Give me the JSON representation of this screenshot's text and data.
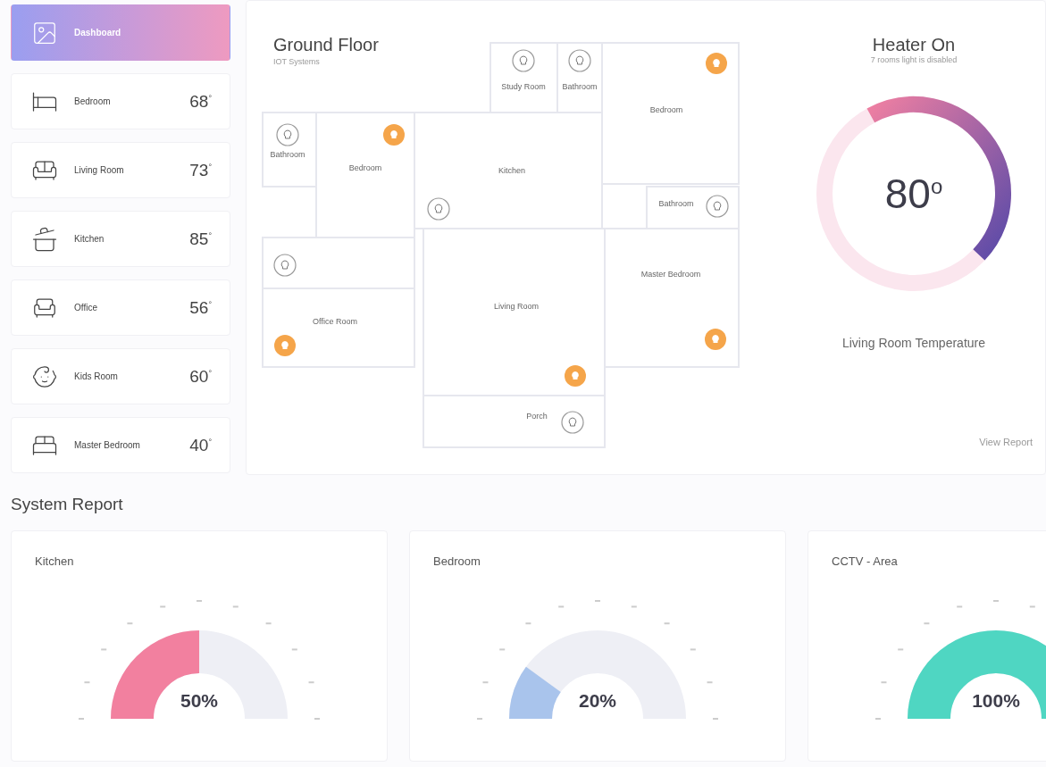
{
  "sidebar": {
    "items": [
      {
        "label": "Dashboard",
        "selected": true
      },
      {
        "label": "Bedroom",
        "temp": "68$^{°}$",
        "selected": false
      },
      {
        "label": "Living Room",
        "temp": "73$^{°}$",
        "selected": false
      },
      {
        "label": "Kitchen",
        "temp": "85$^{°}$",
        "selected": false
      },
      {
        "label": "Office",
        "temp": "56$^{°}$",
        "selected": false
      },
      {
        "label": "Kids Room",
        "temp": "60$^{°}$",
        "selected": false
      },
      {
        "label": "Master Bedroom",
        "temp": "40$^{°}$",
        "selected": false
      }
    ]
  },
  "floor_plan": {
    "title": "Ground Floor",
    "subtitle": "IOT Systems",
    "rooms": [
      "Study Room",
      "Bathroom",
      "Bedroom",
      "Bathroom",
      "Bedroom",
      "Kitchen",
      "Bathroom",
      "Office Room",
      "Living Room",
      "Master Bedroom",
      "Porch"
    ],
    "lights": [
      {
        "on": false
      },
      {
        "on": false
      },
      {
        "on": true
      },
      {
        "on": false
      },
      {
        "on": true
      },
      {
        "on": false
      },
      {
        "on": false
      },
      {
        "on": false
      },
      {
        "on": true
      },
      {
        "on": true
      },
      {
        "on": true
      },
      {
        "on": false
      }
    ]
  },
  "heater": {
    "title": "Heater On",
    "subtitle": "7 rooms light is disabled",
    "reading": "80$^{o}$",
    "caption": "Living Room Temperature",
    "link": "View Report"
  },
  "system_report": {
    "title": "System Report",
    "cards": [
      {
        "title": "Kitchen",
        "reading": "50%"
      },
      {
        "title": "Bedroom",
        "reading": "20%"
      },
      {
        "title": "CCTV - Area",
        "reading": "100%"
      }
    ]
  }
}
